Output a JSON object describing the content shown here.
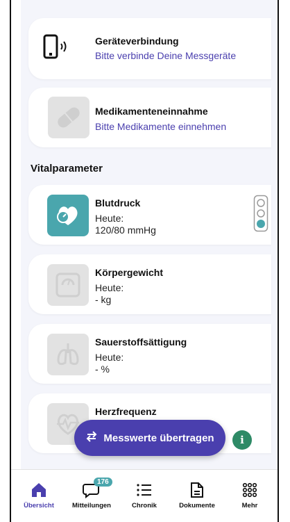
{
  "cards": {
    "device": {
      "title": "Geräteverbindung",
      "subtitle": "Bitte verbinde Deine Messgeräte"
    },
    "medication": {
      "title": "Medikamenteneinnahme",
      "subtitle": "Bitte Medikamente einnehmen"
    }
  },
  "vitals": {
    "section_title": "Vitalparameter",
    "blood_pressure": {
      "title": "Blutdruck",
      "label": "Heute:",
      "value": "120/80 mmHg"
    },
    "weight": {
      "title": "Körpergewicht",
      "label": "Heute:",
      "value": "- kg"
    },
    "oxygen": {
      "title": "Sauerstoffsättigung",
      "label": "Heute:",
      "value": "- %"
    },
    "heart_rate": {
      "title": "Herzfrequenz"
    }
  },
  "actions": {
    "transfer_button": "Messwerte übertragen",
    "info_button": "i"
  },
  "nav": {
    "items": [
      {
        "label": "Übersicht",
        "icon": "home-icon",
        "active": true
      },
      {
        "label": "Mitteilungen",
        "icon": "chat-icon",
        "badge": "176"
      },
      {
        "label": "Chronik",
        "icon": "list-icon"
      },
      {
        "label": "Dokumente",
        "icon": "document-icon"
      },
      {
        "label": "Mehr",
        "icon": "grid-dots-icon"
      }
    ]
  },
  "colors": {
    "accent": "#4a3fae",
    "teal": "#4aa6ad",
    "info_green": "#2e8a66"
  }
}
